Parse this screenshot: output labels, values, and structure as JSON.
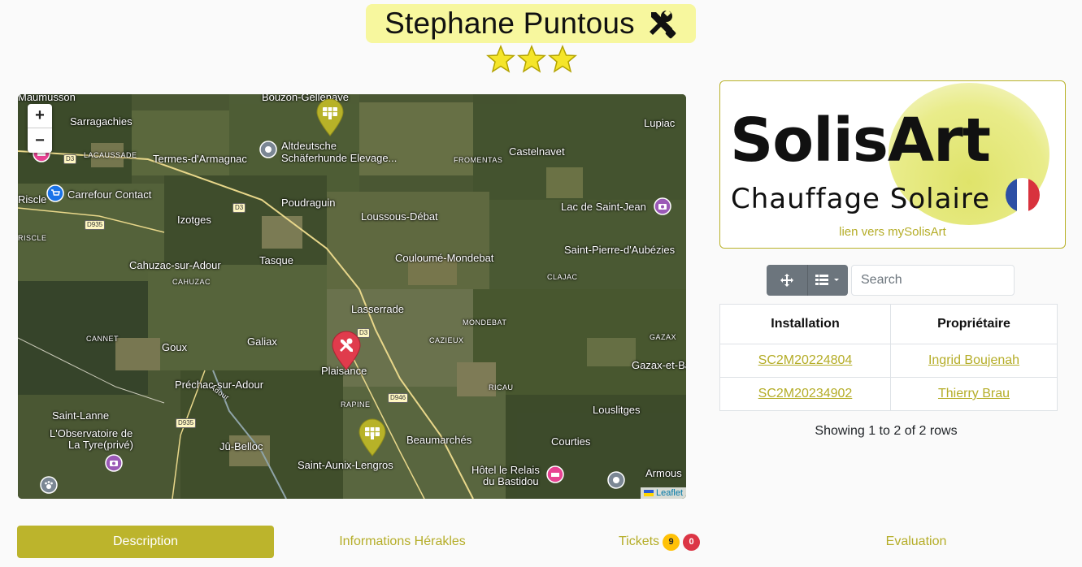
{
  "header": {
    "title": "Stephane Puntous",
    "title_icon": "tools-icon",
    "rating": 3,
    "rating_max": 3
  },
  "map": {
    "zoom_in": "+",
    "zoom_out": "−",
    "attribution": "Leaflet",
    "places": [
      {
        "name": "Bouzon-Gellenave"
      },
      {
        "name": "Sarragachies"
      },
      {
        "name": "Lupiac"
      },
      {
        "name": "LACAUSSADE"
      },
      {
        "name": "Termes-d'Armagnac"
      },
      {
        "name": "Altdeutsche"
      },
      {
        "name": "Schäferhunde Elevage..."
      },
      {
        "name": "FROMENTAS"
      },
      {
        "name": "Castelnavet"
      },
      {
        "name": "Carrefour Contact"
      },
      {
        "name": "Poudraguin"
      },
      {
        "name": "Lac de Saint-Jean"
      },
      {
        "name": "Izotges"
      },
      {
        "name": "Loussous-Débat"
      },
      {
        "name": "Saint-Pierre-d'Aubézies"
      },
      {
        "name": "Cahuzac-sur-Adour"
      },
      {
        "name": "Tasque"
      },
      {
        "name": "Couloumé-Mondebat"
      },
      {
        "name": "CAHUZAC"
      },
      {
        "name": "CLAJAC"
      },
      {
        "name": "Lasserrade"
      },
      {
        "name": "MONDEBAT"
      },
      {
        "name": "CANNET"
      },
      {
        "name": "CAZIEUX"
      },
      {
        "name": "GAZAX"
      },
      {
        "name": "Goux"
      },
      {
        "name": "Galiax"
      },
      {
        "name": "Gazax-et-Baccarisse"
      },
      {
        "name": "Plaisance"
      },
      {
        "name": "Préchac-sur-Adour"
      },
      {
        "name": "RICAU"
      },
      {
        "name": "RAPINE"
      },
      {
        "name": "Louslitges"
      },
      {
        "name": "Saint-Lanne"
      },
      {
        "name": "L'Observatoire de"
      },
      {
        "name": "La Tyre(privé)"
      },
      {
        "name": "Jû-Belloc"
      },
      {
        "name": "Beaumarchés"
      },
      {
        "name": "Courties"
      },
      {
        "name": "Saint-Aunix-Lengros"
      },
      {
        "name": "Hôtel le Relais"
      },
      {
        "name": "du Bastidou"
      },
      {
        "name": "Armous"
      },
      {
        "name": "Riscle"
      },
      {
        "name": "RISCLE"
      },
      {
        "name": "Maumusson"
      },
      {
        "name": "Adour"
      }
    ],
    "roads": [
      "D3",
      "D3",
      "D935",
      "D3",
      "D946",
      "D935"
    ]
  },
  "logo": {
    "brand": "SolisArt",
    "tagline": "Chauffage Solaire",
    "link_label": "lien vers mySolisArt",
    "colors": {
      "accent": "#dfe36a",
      "flag_blue": "#2d4fa5",
      "flag_white": "#ffffff",
      "flag_red": "#d8323d"
    }
  },
  "toolbar": {
    "move_icon": "move-icon",
    "columns_icon": "columns-list-icon",
    "search_placeholder": "Search"
  },
  "table": {
    "columns": [
      "Installation",
      "Propriétaire"
    ],
    "rows": [
      {
        "installation": "SC2M20224804",
        "owner": "Ingrid Boujenah"
      },
      {
        "installation": "SC2M20234902",
        "owner": "Thierry Brau"
      }
    ],
    "showing": "Showing 1 to 2 of 2 rows"
  },
  "tabs": [
    {
      "label": "Description",
      "active": true
    },
    {
      "label": "Informations Hérakles",
      "active": false
    },
    {
      "label": "Tickets",
      "active": false,
      "badges": [
        "9",
        "0"
      ]
    },
    {
      "label": "Evaluation",
      "active": false
    }
  ],
  "colors": {
    "accent": "#bcb42c",
    "link": "#b5ad28",
    "title_bg": "#f7f79e"
  }
}
